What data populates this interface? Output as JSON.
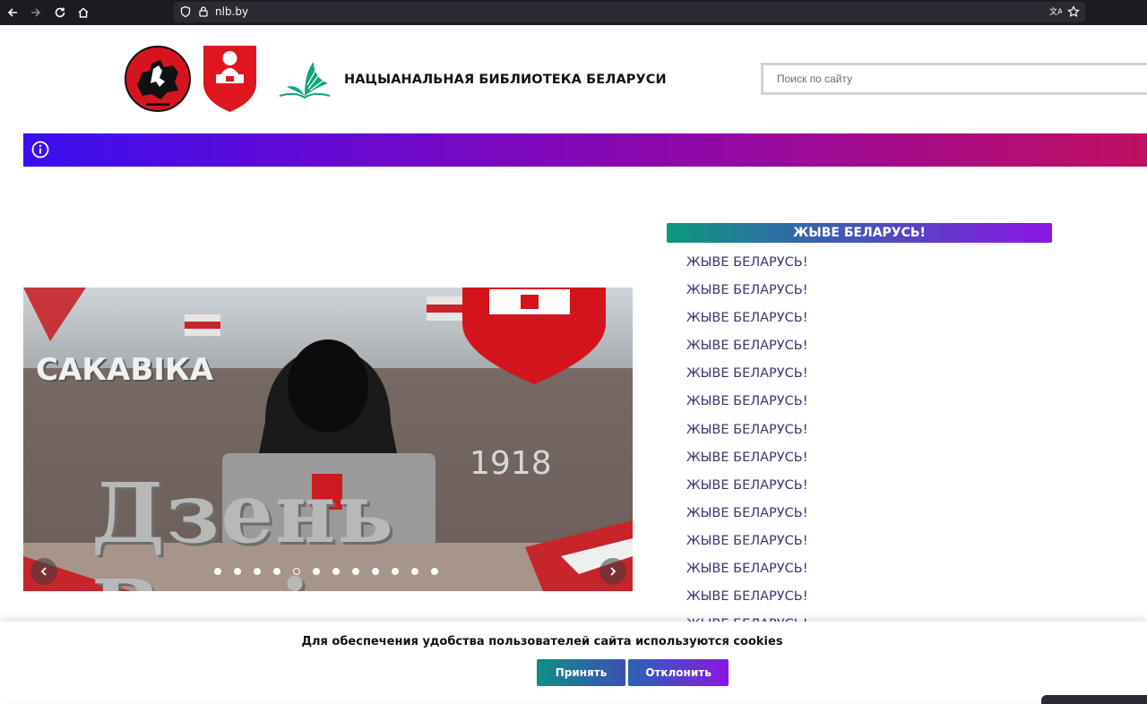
{
  "browser": {
    "url": "nlb.by",
    "icons": [
      "back-icon",
      "forward-icon",
      "reload-icon",
      "home-icon",
      "shield-icon",
      "lock-icon",
      "translate-icon",
      "bookmark-star-icon"
    ]
  },
  "header": {
    "site_title": "НАЦЫАНАЛЬНАЯ БИБЛИОТЕКА БЕЛАРУСИ",
    "search_placeholder": "Поиск по сайту"
  },
  "slider": {
    "date_text": "САКАВІКА",
    "year_text": "1918",
    "title_text": "Дзень Волі",
    "dot_count": 12,
    "active_dot_index": 4
  },
  "side_panel": {
    "heading": "ЖЫВЕ БЕЛАРУСЬ!",
    "items": [
      "ЖЫВЕ БЕЛАРУСЬ!",
      "ЖЫВЕ БЕЛАРУСЬ!",
      "ЖЫВЕ БЕЛАРУСЬ!",
      "ЖЫВЕ БЕЛАРУСЬ!",
      "ЖЫВЕ БЕЛАРУСЬ!",
      "ЖЫВЕ БЕЛАРУСЬ!",
      "ЖЫВЕ БЕЛАРУСЬ!",
      "ЖЫВЕ БЕЛАРУСЬ!",
      "ЖЫВЕ БЕЛАРУСЬ!",
      "ЖЫВЕ БЕЛАРУСЬ!",
      "ЖЫВЕ БЕЛАРУСЬ!",
      "ЖЫВЕ БЕЛАРУСЬ!",
      "ЖЫВЕ БЕЛАРУСЬ!",
      "ЖЫВЕ БЕЛАРУСЬ!"
    ]
  },
  "cookie_banner": {
    "text": "Для обеспечения удобства пользователей сайта используются cookies",
    "accept_label": "Принять",
    "decline_label": "Отклонить"
  },
  "colors": {
    "infobar_start": "#3a0ff0",
    "infobar_end": "#c01060",
    "panel_heading_start": "#0b9a7c",
    "panel_heading_end": "#8a15e6",
    "link_text": "#3a3875"
  }
}
